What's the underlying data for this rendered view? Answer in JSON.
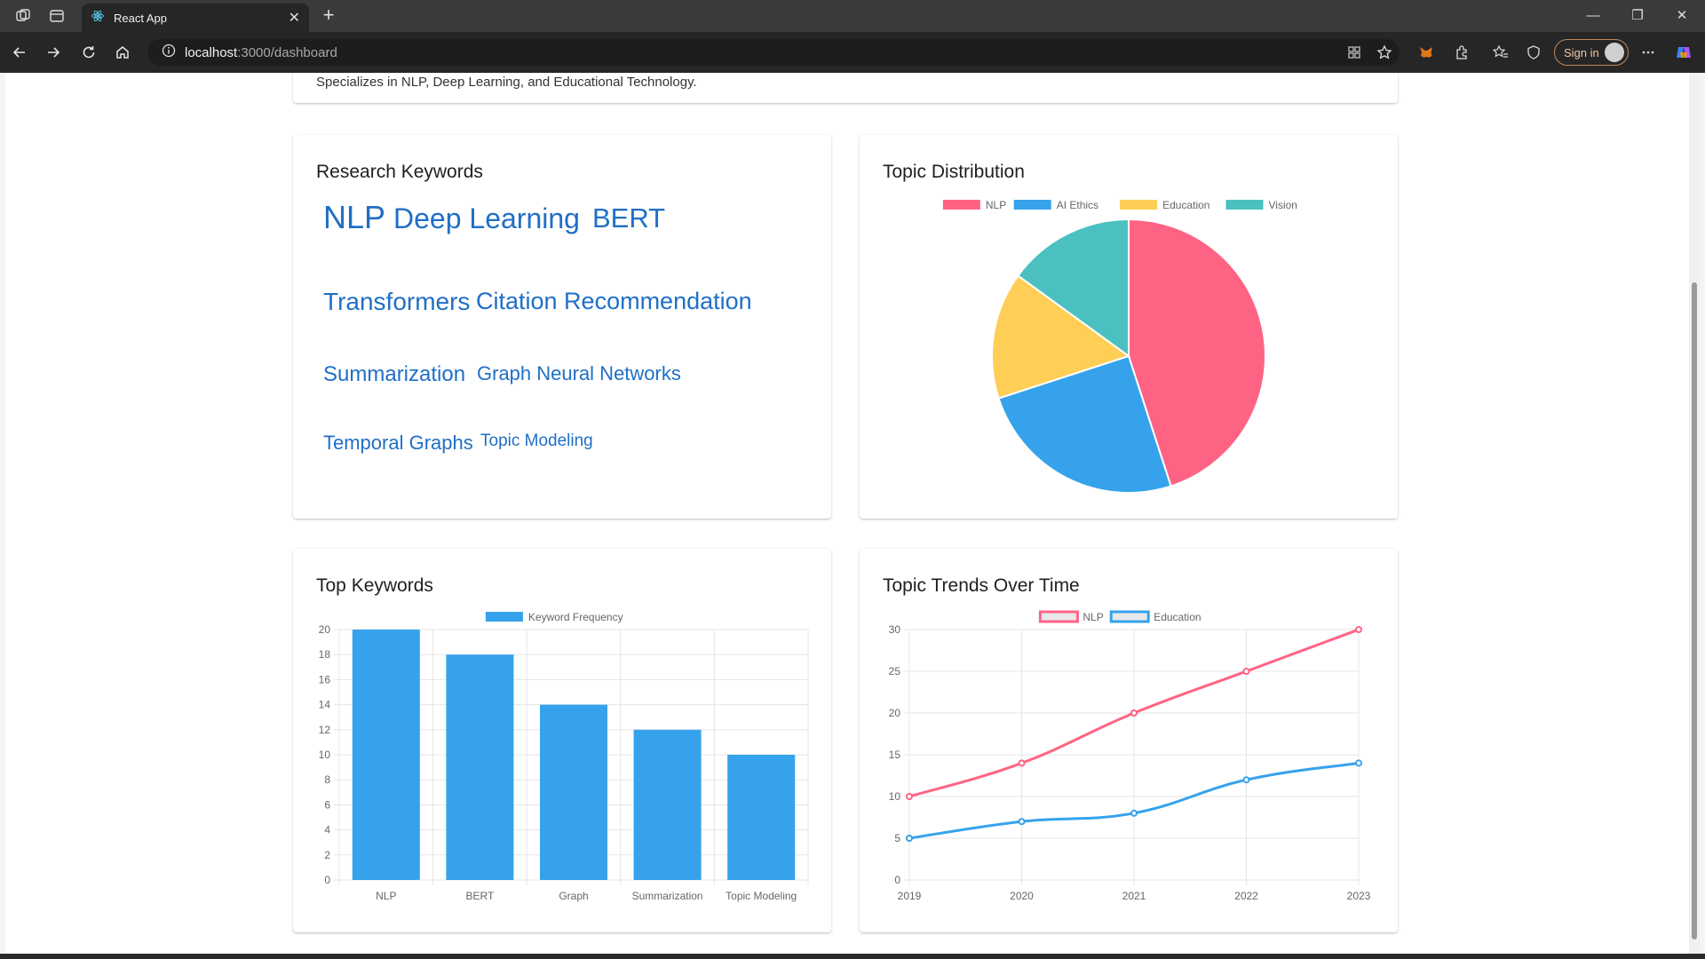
{
  "browser": {
    "tab_title": "React App",
    "url_host": "localhost",
    "url_path": ":3000/dashboard",
    "signin_label": "Sign in"
  },
  "profile": {
    "text": "Specializes in NLP, Deep Learning, and Educational Technology."
  },
  "keywords_card": {
    "title": "Research Keywords",
    "keywords": [
      {
        "text": "NLP"
      },
      {
        "text": "Deep Learning"
      },
      {
        "text": "BERT"
      },
      {
        "text": "Transformers"
      },
      {
        "text": "Citation Recommendation"
      },
      {
        "text": "Summarization"
      },
      {
        "text": "Graph Neural Networks"
      },
      {
        "text": "Temporal Graphs"
      },
      {
        "text": "Topic Modeling"
      }
    ]
  },
  "topic_card": {
    "title": "Topic Distribution"
  },
  "bar_card": {
    "title": "Top Keywords"
  },
  "line_card": {
    "title": "Topic Trends Over Time"
  },
  "colors": {
    "pink": "#ff6384",
    "blue": "#36a2eb",
    "yellow": "#ffce56",
    "teal": "#4bc0c0",
    "keyword_text": "#1f6fc6"
  },
  "chart_data": [
    {
      "type": "pie",
      "title": "Topic Distribution",
      "legend": "top",
      "labels": [
        "NLP",
        "AI Ethics",
        "Education",
        "Vision"
      ],
      "values": [
        45,
        25,
        15,
        15
      ],
      "colors": [
        "#ff6384",
        "#36a2eb",
        "#ffce56",
        "#4bc0c0"
      ]
    },
    {
      "type": "bar",
      "title": "Top Keywords",
      "legend": "top",
      "categories": [
        "NLP",
        "BERT",
        "Graph",
        "Summarization",
        "Topic Modeling"
      ],
      "series": [
        {
          "name": "Keyword Frequency",
          "values": [
            20,
            18,
            14,
            12,
            10
          ],
          "color": "#36a2eb"
        }
      ],
      "ylim": [
        0,
        20
      ],
      "yticks": [
        0,
        2,
        4,
        6,
        8,
        10,
        12,
        14,
        16,
        18,
        20
      ],
      "grid": true
    },
    {
      "type": "line",
      "title": "Topic Trends Over Time",
      "legend": "top",
      "x": [
        "2019",
        "2020",
        "2021",
        "2022",
        "2023"
      ],
      "series": [
        {
          "name": "NLP",
          "values": [
            10,
            14,
            20,
            25,
            30
          ],
          "color": "#ff6384"
        },
        {
          "name": "Education",
          "values": [
            5,
            7,
            8,
            12,
            14
          ],
          "color": "#36a2eb"
        }
      ],
      "ylim": [
        0,
        30
      ],
      "yticks": [
        0,
        5,
        10,
        15,
        20,
        25,
        30
      ],
      "grid": true
    }
  ]
}
